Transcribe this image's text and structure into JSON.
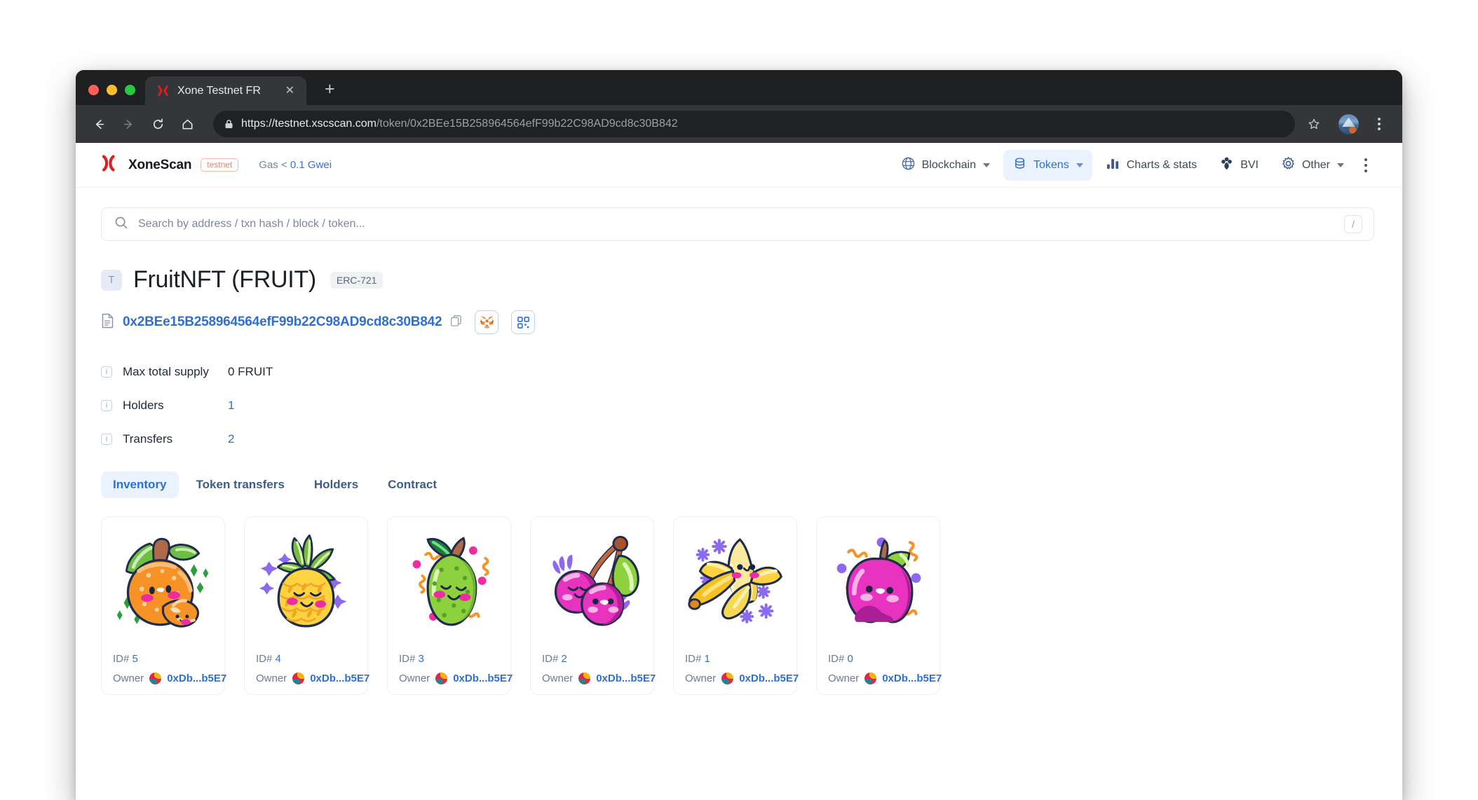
{
  "browser": {
    "tab": {
      "title": "Xone Testnet FR",
      "favicon_icon": "xone-x-logo-icon",
      "close_icon": "close-icon"
    },
    "new_tab_label": "+",
    "back_icon": "back-arrow-icon",
    "forward_icon": "forward-arrow-icon",
    "reload_icon": "reload-icon",
    "home_icon": "home-icon",
    "lock_icon": "lock-icon",
    "url_host": "https://testnet.xscscan.com",
    "url_path": "/token/0x2BEe15B258964564efF99b22C98AD9cd8c30B842",
    "bookmark_icon": "star-icon",
    "profile_icon": "profile-avatar",
    "menu_icon": "kebab-menu-icon"
  },
  "header": {
    "logo_icon": "xonescan-logo-icon",
    "brand": "XoneScan",
    "network_chip": "testnet",
    "gas_prefix": "Gas <",
    "gas_value": "0.1 Gwei",
    "nav": [
      {
        "label": "Blockchain",
        "icon": "globe-icon",
        "chevron": true,
        "active": false
      },
      {
        "label": "Tokens",
        "icon": "coins-icon",
        "chevron": true,
        "active": true
      },
      {
        "label": "Charts & stats",
        "icon": "bar-chart-icon",
        "chevron": false,
        "active": false
      },
      {
        "label": "BVI",
        "icon": "flower-icon",
        "chevron": false,
        "active": false
      },
      {
        "label": "Other",
        "icon": "gear-icon",
        "chevron": true,
        "active": false
      }
    ],
    "overflow_icon": "kebab-menu-icon"
  },
  "search": {
    "placeholder": "Search by address / txn hash / block / token...",
    "icon": "search-icon",
    "shortcut_key": "/"
  },
  "token": {
    "avatar_letter": "T",
    "title": "FruitNFT (FRUIT)",
    "standard_chip": "ERC-721",
    "address": "0x2BEe15B258964564efF99b22C98AD9cd8c30B842",
    "doc_icon": "document-icon",
    "copy_icon": "copy-icon",
    "metamask_icon": "metamask-fox-icon",
    "qr_icon": "qr-code-icon"
  },
  "stats": [
    {
      "label": "Max total supply",
      "value": "0 FRUIT",
      "is_link": false,
      "info_icon": "info-icon"
    },
    {
      "label": "Holders",
      "value": "1",
      "is_link": true,
      "info_icon": "info-icon"
    },
    {
      "label": "Transfers",
      "value": "2",
      "is_link": true,
      "info_icon": "info-icon"
    }
  ],
  "tabs": [
    {
      "label": "Inventory",
      "active": true
    },
    {
      "label": "Token transfers",
      "active": false
    },
    {
      "label": "Holders",
      "active": false
    },
    {
      "label": "Contract",
      "active": false
    }
  ],
  "inventory": {
    "id_prefix": "ID# ",
    "owner_label": "Owner",
    "items": [
      {
        "id": "5",
        "owner": "0xDb...b5E7",
        "art": "orange-tangerine-nft-image"
      },
      {
        "id": "4",
        "owner": "0xDb...b5E7",
        "art": "pineapple-nft-image"
      },
      {
        "id": "3",
        "owner": "0xDb...b5E7",
        "art": "pear-nft-image"
      },
      {
        "id": "2",
        "owner": "0xDb...b5E7",
        "art": "cherries-nft-image"
      },
      {
        "id": "1",
        "owner": "0xDb...b5E7",
        "art": "banana-nft-image"
      },
      {
        "id": "0",
        "owner": "0xDb...b5E7",
        "art": "apple-nft-image"
      }
    ]
  },
  "colors": {
    "accent_blue": "#2f6fd0",
    "brand_red": "#e02020",
    "active_pill": "#eaf3fd",
    "muted_text": "#6e7a8d"
  }
}
